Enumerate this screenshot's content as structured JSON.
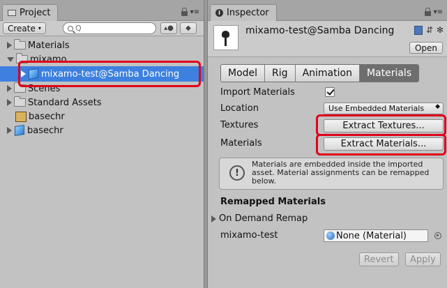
{
  "project": {
    "tab_label": "Project",
    "create_label": "Create",
    "search_placeholder": "Q",
    "tree": [
      {
        "label": "Materials",
        "icon": "folder-icon",
        "expanded": false
      },
      {
        "label": "mixamo",
        "icon": "folder-icon",
        "expanded": true
      },
      {
        "label": "mixamo-test@Samba Dancing",
        "icon": "model-icon",
        "selected": true
      },
      {
        "label": "Scenes",
        "icon": "folder-icon",
        "expanded": false
      },
      {
        "label": "Standard Assets",
        "icon": "folder-icon",
        "expanded": false
      },
      {
        "label": "basechr",
        "icon": "scene-icon"
      },
      {
        "label": "basechr",
        "icon": "model-icon"
      }
    ]
  },
  "inspector": {
    "tab_label": "Inspector",
    "asset_title": "mixamo-test@Samba Dancing",
    "open_label": "Open",
    "tabs": [
      "Model",
      "Rig",
      "Animation",
      "Materials"
    ],
    "active_tab": "Materials",
    "import_materials_label": "Import Materials",
    "import_materials_checked": true,
    "location_label": "Location",
    "location_value": "Use Embedded Materials",
    "textures_label": "Textures",
    "extract_textures_label": "Extract Textures...",
    "materials_label": "Materials",
    "extract_materials_label": "Extract Materials...",
    "help_text": "Materials are embedded inside the imported asset. Material assignments can be remapped below.",
    "remapped_title": "Remapped Materials",
    "on_demand_label": "On Demand Remap",
    "remap_name": "mixamo-test",
    "remap_value": "None (Material)",
    "revert_label": "Revert",
    "apply_label": "Apply"
  },
  "colors": {
    "selection": "#3d80df",
    "highlight": "#e0001a",
    "active_tab": "#6e6e6e"
  }
}
